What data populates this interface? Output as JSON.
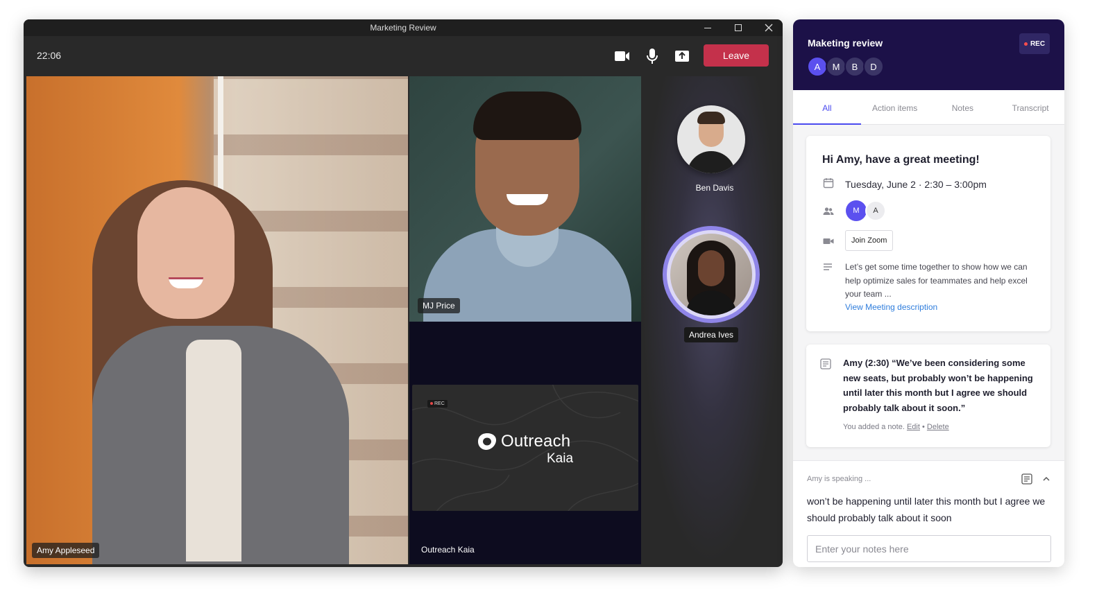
{
  "window": {
    "title": "Marketing Review"
  },
  "toolbar": {
    "clock": "22:06",
    "leave_label": "Leave"
  },
  "participants": {
    "amy": "Amy Appleseed",
    "mj": "MJ Price",
    "kaia": "Outreach Kaia",
    "ben": "Ben Davis",
    "andrea": "Andrea Ives"
  },
  "kaia_card": {
    "rec": "REC",
    "brand": "Outreach",
    "sub": "Kaia"
  },
  "panel": {
    "title": "Maketing review",
    "rec": "REC",
    "avatars": [
      "A",
      "M",
      "B",
      "D"
    ],
    "tabs": [
      "All",
      "Action items",
      "Notes",
      "Transcript"
    ],
    "meeting": {
      "greeting": "Hi Amy, have a great meeting!",
      "date": "Tuesday, June 2 · 2:30 – 3:00pm",
      "attendees": [
        "M",
        "A"
      ],
      "join_label": "Join Zoom",
      "description": "Let’s get some time together to show how we can help optimize sales for teammates and help excel your team ...",
      "view_link": "View Meeting description"
    },
    "note": {
      "quote": "Amy (2:30) “We’ve been considering some new seats, but probably won’t be happening until later this month but I agree we should probably talk about it soon.”",
      "meta": "You added a note.",
      "edit": "Edit",
      "separator": "•",
      "delete": "Delete"
    },
    "live": {
      "speaking": "Amy is speaking ...",
      "text": "won’t be happening until later this month but I agree we should probably talk about it soon",
      "placeholder": "Enter your notes here"
    }
  },
  "colors": {
    "leave": "#c4314b",
    "panel_header": "#1c1148",
    "accent": "#4a4aef",
    "avatar_active": "#5b50ef"
  }
}
